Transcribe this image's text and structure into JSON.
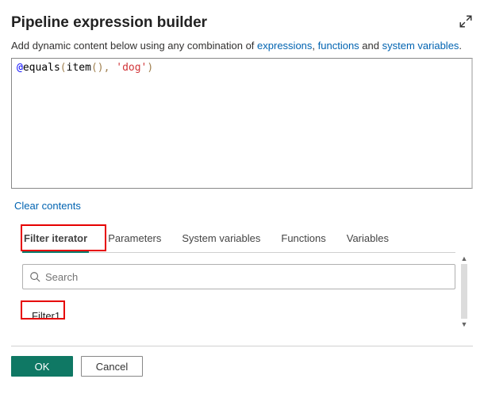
{
  "title": "Pipeline expression builder",
  "hint_prefix": "Add dynamic content below using any combination of ",
  "hint_links": {
    "expressions": "expressions",
    "functions": "functions",
    "system_variables": "system variables"
  },
  "hint_and": " and ",
  "hint_end": ".",
  "code": {
    "at": "@",
    "fn1": "equals",
    "p1": "(",
    "fn2": "item",
    "p2": "(), ",
    "str": "'dog'",
    "p3": ")"
  },
  "clear_contents": "Clear contents",
  "tabs": {
    "filter_iterator": "Filter iterator",
    "parameters": "Parameters",
    "system_variables": "System variables",
    "functions": "Functions",
    "variables": "Variables"
  },
  "search_placeholder": "Search",
  "filter_item": "Filter1",
  "buttons": {
    "ok": "OK",
    "cancel": "Cancel"
  }
}
